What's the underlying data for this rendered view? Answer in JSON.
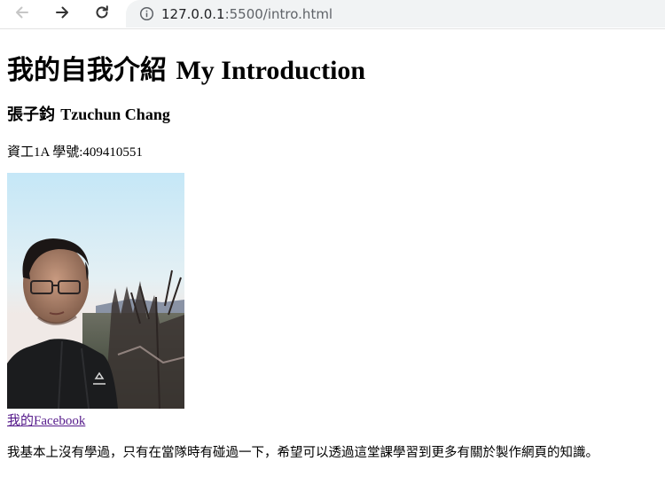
{
  "browser": {
    "url_host": "127.0.0.1",
    "url_path": ":5500/intro.html",
    "icons": {
      "back": "arrow-left-icon",
      "forward": "arrow-right-icon",
      "reload": "reload-icon",
      "info": "info-circle-icon"
    }
  },
  "page": {
    "heading_cjk": "我的自我介紹",
    "heading_latin": "My Introduction",
    "name_cjk": "張子鈞",
    "name_latin": "Tzuchun Chang",
    "student_info": "資工1A 學號:409410551",
    "facebook_link": "我的Facebook",
    "about": "我基本上沒有學過，只有在當隊時有碰過一下，希望可以透過這堂課學習到更多有關於製作網頁的知識。"
  },
  "colors": {
    "link_visited": "#551a8b",
    "address_bar_bg": "#f1f3f4"
  }
}
